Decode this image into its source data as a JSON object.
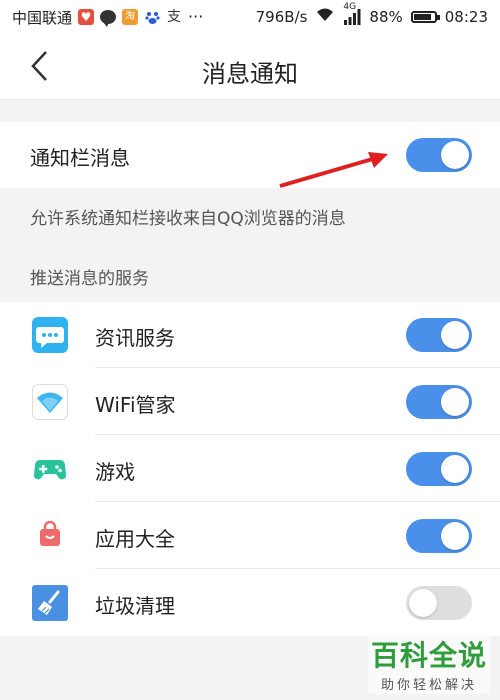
{
  "status_bar": {
    "carrier": "中国联通",
    "speed": "796B/s",
    "network": "4G",
    "battery": "88%",
    "time": "08:23",
    "icons": [
      "weibo-icon",
      "chat-icon",
      "taobao-icon",
      "baidu-icon",
      "alipay-icon",
      "more-dots-icon"
    ],
    "icon_glyphs": {
      "taobao": "淘",
      "alipay": "支",
      "dots": "···"
    }
  },
  "header": {
    "title": "消息通知",
    "back_icon": "chevron-left-icon"
  },
  "notification_bar": {
    "label": "通知栏消息",
    "enabled": true
  },
  "description": "允许系统通知栏接收来自QQ浏览器的消息",
  "section_title": "推送消息的服务",
  "services": [
    {
      "name": "资讯服务",
      "icon": "news-chat-icon",
      "enabled": true
    },
    {
      "name": "WiFi管家",
      "icon": "wifi-icon",
      "enabled": true
    },
    {
      "name": "游戏",
      "icon": "gamepad-icon",
      "enabled": true
    },
    {
      "name": "应用大全",
      "icon": "shopping-bag-icon",
      "enabled": true
    },
    {
      "name": "垃圾清理",
      "icon": "broom-icon",
      "enabled": false
    }
  ],
  "colors": {
    "toggle_on": "#4a8fea",
    "toggle_off": "#dedede",
    "annotation_arrow": "#e02020"
  },
  "watermark": {
    "main": "百科全说",
    "sub": "助你轻松解决"
  }
}
